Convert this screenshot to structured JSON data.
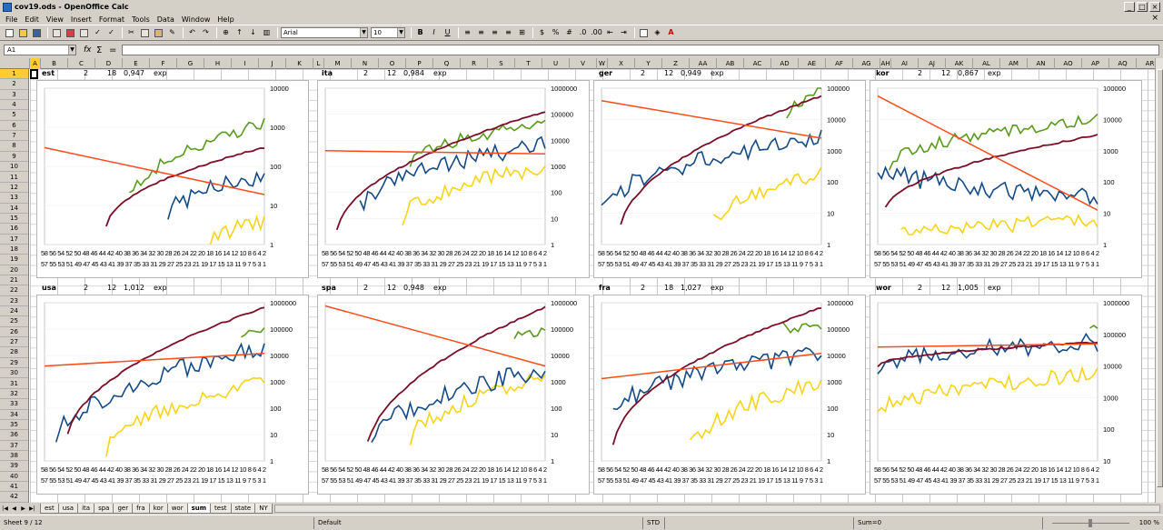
{
  "window": {
    "title": "cov19.ods - OpenOffice Calc"
  },
  "menu": [
    "File",
    "Edit",
    "View",
    "Insert",
    "Format",
    "Tools",
    "Data",
    "Window",
    "Help"
  ],
  "toolbar": {
    "font_name": "Arial",
    "font_size": "10"
  },
  "formula_bar": {
    "name_box": "A1",
    "fx": "fx",
    "sum": "Σ",
    "equals": "="
  },
  "columns": [
    "A",
    "B",
    "C",
    "D",
    "E",
    "F",
    "G",
    "H",
    "I",
    "J",
    "K",
    "L",
    "M",
    "N",
    "O",
    "P",
    "Q",
    "R",
    "S",
    "T",
    "U",
    "V",
    "W",
    "X",
    "Y",
    "Z",
    "AA",
    "AB",
    "AC",
    "AD",
    "AE",
    "AF",
    "AG",
    "AH",
    "AI",
    "AJ",
    "AK",
    "AL",
    "AM",
    "AN",
    "AO",
    "AP",
    "AQ",
    "AR"
  ],
  "rows": [
    "1",
    "2",
    "3",
    "4",
    "5",
    "6",
    "7",
    "8",
    "9",
    "10",
    "11",
    "12",
    "13",
    "14",
    "15",
    "16",
    "17",
    "18",
    "19",
    "20",
    "21",
    "22",
    "23",
    "24",
    "25",
    "26",
    "27",
    "28",
    "29",
    "30",
    "31",
    "32",
    "33",
    "34",
    "35",
    "36",
    "37",
    "38",
    "39",
    "40",
    "41",
    "42",
    "43"
  ],
  "colors": {
    "dark_red": "#7b0e27",
    "green": "#5a9a1c",
    "blue": "#144a86",
    "yellow": "#f7d41a",
    "orange": "#ff4b1a"
  },
  "top_row_labels": [
    {
      "country": "est",
      "n": "2",
      "days": "18",
      "r": "0,947",
      "kind": "exp"
    },
    {
      "country": "ita",
      "n": "2",
      "days": "12",
      "r": "0,984",
      "kind": "exp"
    },
    {
      "country": "ger",
      "n": "2",
      "days": "12",
      "r": "0,949",
      "kind": "exp"
    },
    {
      "country": "kor",
      "n": "2",
      "days": "12",
      "r": "0,867",
      "kind": "exp"
    }
  ],
  "bottom_row_labels": [
    {
      "country": "usa",
      "n": "2",
      "days": "12",
      "r": "1,012",
      "kind": "exp"
    },
    {
      "country": "spa",
      "n": "2",
      "days": "12",
      "r": "0,948",
      "kind": "exp"
    },
    {
      "country": "fra",
      "n": "2",
      "days": "18",
      "r": "1,027",
      "kind": "exp"
    },
    {
      "country": "wor",
      "n": "2",
      "days": "12",
      "r": "1,005",
      "kind": "exp"
    }
  ],
  "chart_data": [
    {
      "type": "line",
      "scale": "log",
      "y_ticks": [
        "10000",
        "1000",
        "100",
        "10",
        "1"
      ],
      "x_labels_top": "58 56 54 52 50 48 46 44 42 40 38 36 34 32 30 28 26 24 22 20 18 16 14 12 10 8 6 4 2",
      "x_labels_bottom": "57 55 53 51 49 47 45 43 41 39 37 35 33 31 29 27 25 23 21 19 17 15 13 11 9 7 5 3 1"
    },
    {
      "type": "line",
      "scale": "log",
      "y_ticks": [
        "1000000",
        "100000",
        "10000",
        "1000",
        "100",
        "10",
        "1"
      ],
      "x_labels_top": "58 56 54 52 50 48 46 44 42 40 38 36 34 32 30 28 26 24 22 20 18 16 14 12 10 8 6 4 2",
      "x_labels_bottom": "57 55 53 51 49 47 45 43 41 39 37 35 33 31 29 27 25 23 21 19 17 15 13 11 9 7 5 3 1"
    },
    {
      "type": "line",
      "scale": "log",
      "y_ticks": [
        "100000",
        "10000",
        "1000",
        "100",
        "10",
        "1"
      ],
      "x_labels_top": "58 56 54 52 50 48 46 44 42 40 38 36 34 32 30 28 26 24 22 20 18 16 14 12 10 8 6 4 2",
      "x_labels_bottom": "57 55 53 51 49 47 45 43 41 39 37 35 33 31 29 27 25 23 21 19 17 15 13 11 9 7 5 3 1"
    },
    {
      "type": "line",
      "scale": "log",
      "y_ticks": [
        "100000",
        "10000",
        "1000",
        "100",
        "10",
        "1"
      ],
      "x_labels_top": "58 56 54 52 50 48 46 44 42 40 38 36 34 32 30 28 26 24 22 20 18 16 14 12 10 8 6 4 2",
      "x_labels_bottom": "57 55 53 51 49 47 45 43 41 39 37 35 33 31 29 27 25 23 21 19 17 15 13 11 9 7 5 3 1"
    },
    {
      "type": "line",
      "scale": "log",
      "y_ticks": [
        "1000000",
        "100000",
        "10000",
        "1000",
        "100",
        "10",
        "1"
      ],
      "x_labels_top": "58 56 54 52 50 48 46 44 42 40 38 36 34 32 30 28 26 24 22 20 18 16 14 12 10 8 6 4 2",
      "x_labels_bottom": "57 55 53 51 49 47 45 43 41 39 37 35 33 31 29 27 25 23 21 19 17 15 13 11 9 7 5 3 1"
    },
    {
      "type": "line",
      "scale": "log",
      "y_ticks": [
        "1000000",
        "100000",
        "10000",
        "1000",
        "100",
        "10",
        "1"
      ],
      "x_labels_top": "58 56 54 52 50 48 46 44 42 40 38 36 34 32 30 28 26 24 22 20 18 16 14 12 10 8 6 4 2",
      "x_labels_bottom": "57 55 53 51 49 47 45 43 41 39 37 35 33 31 29 27 25 23 21 19 17 15 13 11 9 7 5 3 1"
    },
    {
      "type": "line",
      "scale": "log",
      "y_ticks": [
        "1000000",
        "100000",
        "10000",
        "1000",
        "100",
        "10",
        "1"
      ],
      "x_labels_top": "58 56 54 52 50 48 46 44 42 40 38 36 34 32 30 28 26 24 22 20 18 16 14 12 10 8 6 4 2",
      "x_labels_bottom": "57 55 53 51 49 47 45 43 41 39 37 35 33 31 29 27 25 23 21 19 17 15 13 11 9 7 5 3 1"
    },
    {
      "type": "line",
      "scale": "log",
      "y_ticks": [
        "1000000",
        "100000",
        "10000",
        "1000",
        "100",
        "10"
      ],
      "x_labels_top": "58 56 54 52 50 48 46 44 42 40 38 36 34 32 30 28 26 24 22 20 18 16 14 12 10 8 6 4 2",
      "x_labels_bottom": "57 55 53 51 49 47 45 43 41 39 37 35 33 31 29 27 25 23 21 19 17 15 13 11 9 7 5 3 1"
    }
  ],
  "tabs": [
    "est",
    "usa",
    "ita",
    "spa",
    "ger",
    "fra",
    "kor",
    "wor",
    "sum",
    "test",
    "state",
    "NY"
  ],
  "active_tab": "sum",
  "status": {
    "sheet": "Sheet 9 / 12",
    "style": "Default",
    "mode": "STD",
    "sum": "Sum=0",
    "zoom": "100 %"
  }
}
